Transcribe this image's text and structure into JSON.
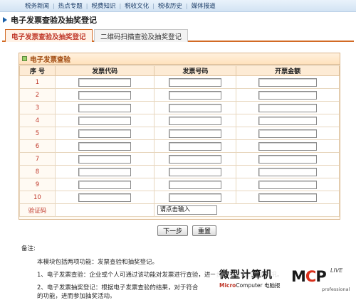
{
  "nav": {
    "items": [
      "税务新闻",
      "热点专题",
      "税费知识",
      "税收文化",
      "税收历史",
      "媒体报道"
    ]
  },
  "header": {
    "title": "电子发票查验及抽奖登记"
  },
  "tabs": [
    {
      "label": "电子发票查验及抽奖登记",
      "active": true
    },
    {
      "label": "二维码扫描查验及抽奖登记",
      "active": false
    }
  ],
  "panel": {
    "title": "电子发票查验"
  },
  "table": {
    "columns": [
      "序 号",
      "发票代码",
      "发票号码",
      "开票金额"
    ],
    "rows": [
      "1",
      "2",
      "3",
      "4",
      "5",
      "6",
      "7",
      "8",
      "9",
      "10"
    ],
    "captcha_label": "验证码",
    "captcha_link": "请点击输入"
  },
  "buttons": {
    "next": "下一步",
    "reset": "重置"
  },
  "notes": {
    "title": "备注:",
    "intro": "本模块包括两项功能：发票查验和抽奖登记。",
    "item1": "1、电子发票查验：企业或个人可通过该功能对发票进行查验，进一步知晓发票的基本情况。",
    "item2": "2、电子发票抽奖登记：根据电子发票查验的结果，对于符合",
    "item2b": "的功能，进而参加抽奖活动。"
  },
  "watermark": {
    "cn": "微型计算机",
    "en_a": "Micro",
    "en_b": "Computer",
    "en_c": " 电脑报",
    "logo_a": "M",
    "logo_b": "C",
    "logo_c": "P",
    "live": "LIVE",
    "pro": "professional"
  },
  "colors": {
    "accent": "#d26a25",
    "nav_bg": "#d2e3f3",
    "red_text": "#c0392b"
  }
}
